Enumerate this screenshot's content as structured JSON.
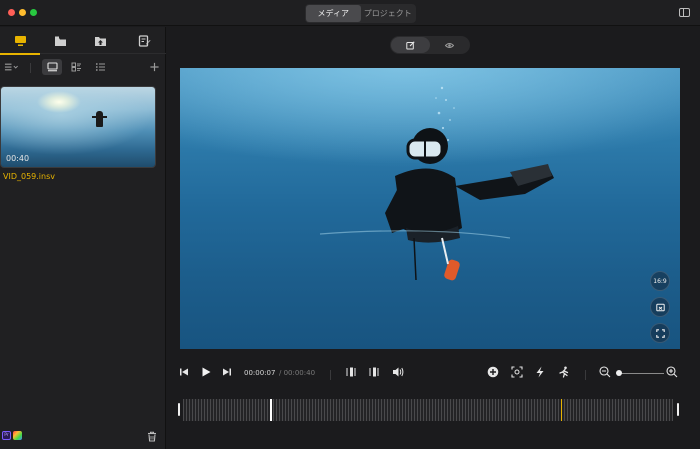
{
  "window": {
    "traffic_lights": [
      "#ff5f57",
      "#febc2e",
      "#28c840"
    ]
  },
  "header": {
    "tabs": [
      {
        "label": "メディア",
        "active": true
      },
      {
        "label": "プロジェクト",
        "active": false
      }
    ]
  },
  "left_panel": {
    "tabs": [
      {
        "icon": "media-icon",
        "active": true
      },
      {
        "icon": "folder-icon",
        "active": false
      },
      {
        "icon": "export-folder-icon",
        "active": false
      },
      {
        "icon": "task-edit-icon",
        "active": false
      }
    ],
    "toolbar": {
      "view_modes": [
        "large-thumbnail",
        "grid",
        "list"
      ],
      "active_view": "large-thumbnail",
      "sort_icon": "sort-icon",
      "add_icon": "plus-icon"
    },
    "media_items": [
      {
        "filename": "VID_059.insv",
        "duration": "00:40"
      }
    ],
    "badges": {
      "premiere": "Pr",
      "fcpx": "fcp-icon"
    }
  },
  "player": {
    "mode_tabs": [
      "edit-icon",
      "preview-eye-icon"
    ],
    "side_buttons": {
      "aspect_ratio": "16:9"
    },
    "time_current": "00:00:07",
    "time_total": "/ 00:00:40",
    "zoom_level": 0.05
  },
  "colors": {
    "accent": "#e8b400",
    "background": "#1b1b1d",
    "panel": "#202022"
  }
}
